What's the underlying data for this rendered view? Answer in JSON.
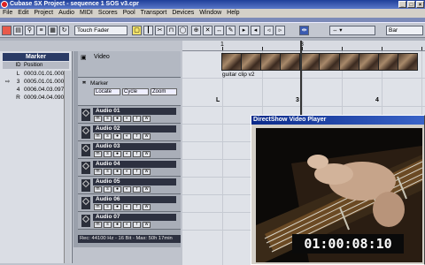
{
  "window": {
    "title": "Cubase SX Project - sequence 1 SOS v3.cpr"
  },
  "menu": [
    "File",
    "Edit",
    "Project",
    "Audio",
    "MIDI",
    "Scores",
    "Pool",
    "Transport",
    "Devices",
    "Window",
    "Help"
  ],
  "toolbar": {
    "automation_mode": "Touch Fader",
    "snap_value": "Bar"
  },
  "marker_panel": {
    "title": "Marker",
    "columns": [
      "ID",
      "Position"
    ],
    "rows": [
      {
        "id": "L",
        "position": "0003.01.01.000"
      },
      {
        "id": "3",
        "position": "0005.01.01.000"
      },
      {
        "id": "4",
        "position": "0006.04.03.097"
      },
      {
        "id": "R",
        "position": "0009.04.04.090"
      }
    ]
  },
  "tracks": {
    "video_label": "Video",
    "marker_label": "Marker",
    "marker_controls": [
      "Locate",
      "Cycle",
      "Zoom"
    ],
    "audio": [
      "Audio 01",
      "Audio 02",
      "Audio 03",
      "Audio 04",
      "Audio 05",
      "Audio 06",
      "Audio 07"
    ]
  },
  "status_bar": "Rec: 44100 Hz - 16 Bit - Max: 50h 17min",
  "ruler": {
    "numbers": [
      "1",
      "3"
    ]
  },
  "arrange": {
    "clip_name": "guitar clip v2",
    "locators": [
      "L",
      "3",
      "4"
    ]
  },
  "player": {
    "title": "DirectShow Video Player",
    "timecode": "01:00:08:10"
  },
  "colors": {
    "title_bar": "#1f3f9a",
    "track_name_bg": "#2d3140",
    "selected_tool": "#f3e26a"
  }
}
